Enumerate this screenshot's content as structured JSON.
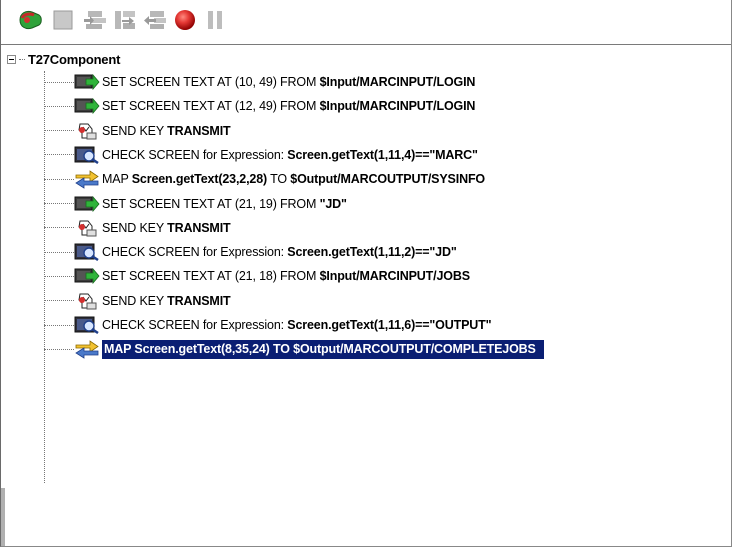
{
  "toolbar": {
    "buttons": [
      {
        "icon": "run-icon"
      },
      {
        "icon": "stop-icon"
      },
      {
        "icon": "step-into-icon"
      },
      {
        "icon": "step-over-icon"
      },
      {
        "icon": "step-out-icon"
      },
      {
        "icon": "breakpoint-icon"
      },
      {
        "icon": "pause-icon"
      }
    ]
  },
  "tree": {
    "root_label": "T27Component",
    "items": [
      {
        "icon": "set-screen-text-icon",
        "prefix": "SET SCREEN TEXT AT (10, 49) FROM ",
        "bold": "$Input/MARCINPUT/LOGIN",
        "mid": "",
        "bold2": ""
      },
      {
        "icon": "set-screen-text-icon",
        "prefix": "SET SCREEN TEXT AT (12, 49) FROM ",
        "bold": "$Input/MARCINPUT/LOGIN",
        "mid": "",
        "bold2": ""
      },
      {
        "icon": "send-key-icon",
        "prefix": "SEND KEY ",
        "bold": "TRANSMIT",
        "mid": "",
        "bold2": ""
      },
      {
        "icon": "check-screen-icon",
        "prefix": "CHECK SCREEN for Expression: ",
        "bold": "Screen.getText(1,11,4)==\"MARC\"",
        "mid": "",
        "bold2": ""
      },
      {
        "icon": "map-icon",
        "prefix": "MAP ",
        "bold": "Screen.getText(23,2,28)",
        "mid": " TO ",
        "bold2": "$Output/MARCOUTPUT/SYSINFO"
      },
      {
        "icon": "set-screen-text-icon",
        "prefix": "SET SCREEN TEXT AT (21, 19) FROM ",
        "bold": "\"JD\"",
        "mid": "",
        "bold2": ""
      },
      {
        "icon": "send-key-icon",
        "prefix": "SEND KEY ",
        "bold": "TRANSMIT",
        "mid": "",
        "bold2": ""
      },
      {
        "icon": "check-screen-icon",
        "prefix": "CHECK SCREEN for Expression: ",
        "bold": "Screen.getText(1,11,2)==\"JD\"",
        "mid": "",
        "bold2": ""
      },
      {
        "icon": "set-screen-text-icon",
        "prefix": "SET SCREEN TEXT AT (21, 18) FROM ",
        "bold": "$Input/MARCINPUT/JOBS",
        "mid": "",
        "bold2": ""
      },
      {
        "icon": "send-key-icon",
        "prefix": "SEND KEY ",
        "bold": "TRANSMIT",
        "mid": "",
        "bold2": ""
      },
      {
        "icon": "check-screen-icon",
        "prefix": "CHECK SCREEN for Expression: ",
        "bold": "Screen.getText(1,11,6)==\"OUTPUT\"",
        "mid": "",
        "bold2": ""
      },
      {
        "icon": "map-icon",
        "prefix": "",
        "bold": "MAP Screen.getText(8,35,24) TO $Output/MARCOUTPUT/COMPLETEJOBS",
        "mid": "",
        "bold2": "",
        "selected": true
      }
    ]
  }
}
